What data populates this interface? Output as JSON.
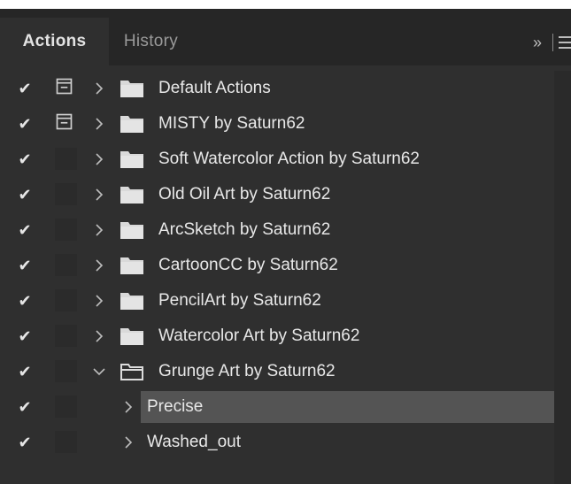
{
  "panel": {
    "tabs": [
      {
        "label": "Actions",
        "active": true
      },
      {
        "label": "History",
        "active": false
      }
    ],
    "expand_glyph": "»"
  },
  "rows": [
    {
      "type": "set",
      "label": "Default Actions",
      "checked": true,
      "dialog": true,
      "expanded": false
    },
    {
      "type": "set",
      "label": "MISTY by Saturn62",
      "checked": true,
      "dialog": true,
      "expanded": false
    },
    {
      "type": "set",
      "label": "Soft Watercolor Action by Saturn62",
      "checked": true,
      "dialog": false,
      "expanded": false
    },
    {
      "type": "set",
      "label": "Old Oil Art by Saturn62",
      "checked": true,
      "dialog": false,
      "expanded": false
    },
    {
      "type": "set",
      "label": "ArcSketch by Saturn62",
      "checked": true,
      "dialog": false,
      "expanded": false
    },
    {
      "type": "set",
      "label": "CartoonCC by Saturn62",
      "checked": true,
      "dialog": false,
      "expanded": false
    },
    {
      "type": "set",
      "label": "PencilArt by Saturn62",
      "checked": true,
      "dialog": false,
      "expanded": false
    },
    {
      "type": "set",
      "label": "Watercolor Art by Saturn62",
      "checked": true,
      "dialog": false,
      "expanded": false
    },
    {
      "type": "set",
      "label": "Grunge Art by Saturn62",
      "checked": true,
      "dialog": false,
      "expanded": true
    },
    {
      "type": "action",
      "label": "Precise",
      "checked": true,
      "dialog": false,
      "expanded": false,
      "selected": true
    },
    {
      "type": "action",
      "label": "Washed_out",
      "checked": true,
      "dialog": false,
      "expanded": false
    }
  ],
  "colors": {
    "panel_bg": "#2f2f2f",
    "tabbar_bg": "#262626",
    "selected_row": "#545454",
    "text": "#e8e8e8"
  }
}
